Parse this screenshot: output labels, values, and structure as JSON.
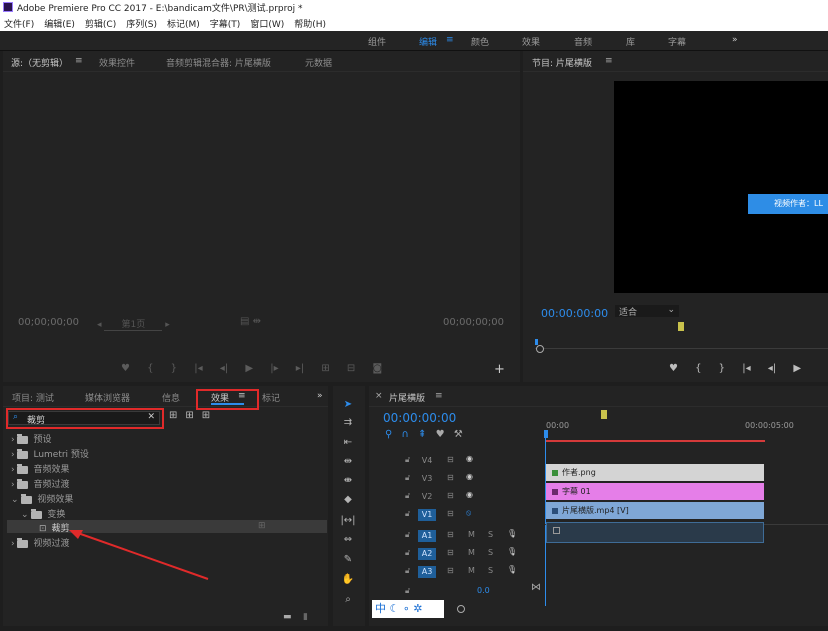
{
  "app": {
    "title": "Adobe Premiere Pro CC 2017 - E:\\bandicam文件\\PR\\测试.prproj *"
  },
  "menu": [
    "文件(F)",
    "编辑(E)",
    "剪辑(C)",
    "序列(S)",
    "标记(M)",
    "字幕(T)",
    "窗口(W)",
    "帮助(H)"
  ],
  "workspaces": {
    "items": [
      "组件",
      "编辑",
      "颜色",
      "效果",
      "音频",
      "库",
      "字幕"
    ],
    "active": "编辑",
    "overflow": "»"
  },
  "source_panel": {
    "tabs": [
      "源:（无剪辑）",
      "效果控件",
      "音频剪辑混合器: 片尾横版",
      "元数据"
    ],
    "timecode_left": "00;00;00;00",
    "timecode_right": "00;00;00;00",
    "zoom": "第1页"
  },
  "program_panel": {
    "tab": "节目: 片尾横版",
    "timecode": "00:00:00:00",
    "fit": "适合",
    "overlay_text": "视频作者：LL"
  },
  "project_panel": {
    "tabs": [
      "项目: 测试",
      "媒体浏览器",
      "信息",
      "效果",
      "标记"
    ],
    "active_tab": "效果",
    "search_value": "裁剪",
    "tree": [
      {
        "label": "预设",
        "indent": 0,
        "open": false
      },
      {
        "label": "Lumetri 预设",
        "indent": 0,
        "open": false
      },
      {
        "label": "音频效果",
        "indent": 0,
        "open": false
      },
      {
        "label": "音频过渡",
        "indent": 0,
        "open": false
      },
      {
        "label": "视频效果",
        "indent": 0,
        "open": true
      },
      {
        "label": "变换",
        "indent": 1,
        "open": true
      },
      {
        "label": "裁剪",
        "indent": 2,
        "selected": true
      },
      {
        "label": "视频过渡",
        "indent": 0,
        "open": false
      }
    ]
  },
  "timeline": {
    "tab": "片尾横版",
    "timecode": "00:00:00:00",
    "ruler": [
      "00:00",
      "00:00:05:00"
    ],
    "video_tracks": [
      "V4",
      "V3",
      "V2",
      "V1"
    ],
    "audio_tracks": [
      "A1",
      "A2",
      "A3"
    ],
    "master_value": "0.0",
    "clips": {
      "v3": "作者.png",
      "v2": "字幕 01",
      "v1": "片尾横版.mp4 [V]"
    },
    "track_letters": {
      "mute": "M",
      "solo": "S"
    },
    "ime": "中"
  },
  "colors": {
    "accent": "#2d8ceb",
    "clip_v3": "#d4d4d4",
    "clip_v2": "#e57ee8",
    "clip_v1": "#7fa7d6",
    "annotation": "#e02a2a"
  }
}
